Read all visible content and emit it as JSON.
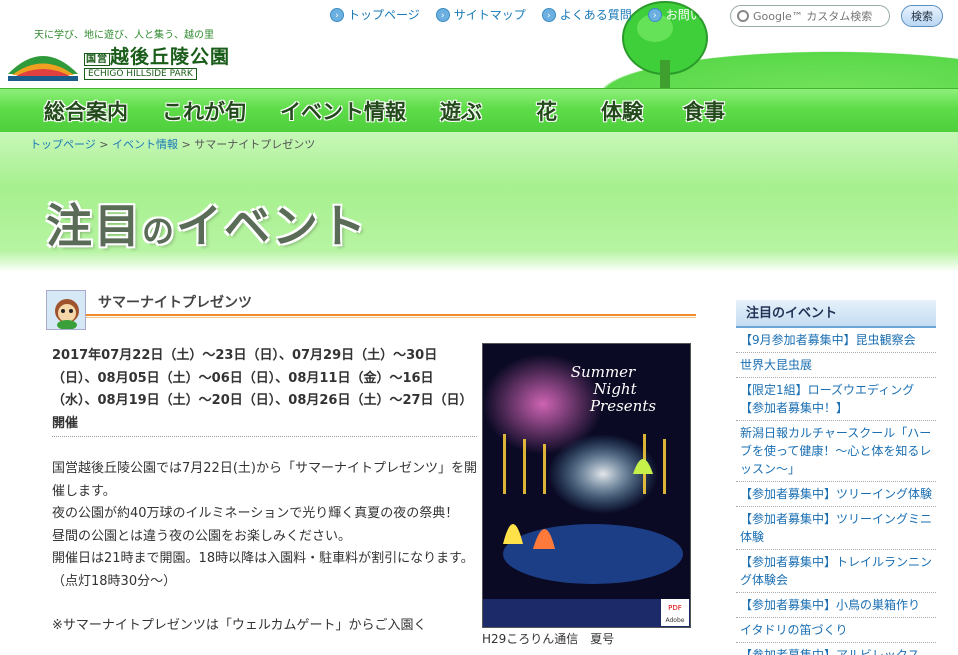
{
  "header": {
    "tagline": "天に学び、地に遊び、人と集う、越の里",
    "logo_name": "越後丘陵公園",
    "logo_prefix": "国営",
    "logo_en": "ECHIGO HILLSIDE PARK",
    "top_links": [
      "トップページ",
      "サイトマップ",
      "よくある質問",
      "お問い合せ"
    ],
    "search_placeholder": "Google™ カスタム検索",
    "search_button": "検索"
  },
  "main_nav": [
    "総合案内",
    "これが旬",
    "イベント情報",
    "遊ぶ",
    "花",
    "体験",
    "食事"
  ],
  "breadcrumb": {
    "home": "トップページ",
    "events": "イベント情報",
    "current": "サマーナイトプレゼンツ",
    "sep": ">"
  },
  "hero": {
    "title_a": "注目",
    "title_no": "の",
    "title_b": "イベント"
  },
  "article": {
    "title": "サマーナイトプレゼンツ",
    "dates": "2017年07月22日（土）～23日（日）、07月29日（土）～30日（日）、08月05日（土）～06日（日）、08月11日（金）～16日（水）、08月19日（土）～20日（日）、08月26日（土）～27日（日）開催",
    "p1": "国営越後丘陵公園では7月22日(土)から「サマーナイトプレゼンツ」を開催します。",
    "p2": "夜の公園が約40万球のイルミネーションで光り輝く真夏の夜の祭典！",
    "p3": "昼間の公園とは違う夜の公園をお楽しみください。",
    "p4": "開催日は21時まで開園。18時以降は入園料・駐車料が割引になります。（点灯18時30分～）",
    "note": "※サマーナイトプレゼンツは「ウェルカムゲート」からご入園く",
    "poster_caption": "H29ころりん通信　夏号",
    "poster_title_1": "Summer",
    "poster_title_2": "Night",
    "poster_title_3": "Presents",
    "pdf_label": "PDF",
    "adobe_label": "Adobe"
  },
  "sidebar": {
    "heading": "注目のイベント",
    "items": [
      "【9月参加者募集中】昆虫観察会",
      "世界大昆虫展",
      "【限定1組】ローズウエディング【参加者募集中！】",
      "新潟日報カルチャースクール「ハーブを使って健康！～心と体を知るレッスン～」",
      "【参加者募集中】ツリーイング体験",
      "【参加者募集中】ツリーイングミニ体験",
      "【参加者募集中】トレイルランニング体験会",
      "【参加者募集中】小鳥の巣箱作り",
      "イタドリの笛づくり",
      "【参加者募集中】アルビレックス"
    ]
  },
  "colors": {
    "nav_green": "#5fdc4a",
    "title_orange": "#f08c2c",
    "link_blue": "#1a7ab8"
  }
}
